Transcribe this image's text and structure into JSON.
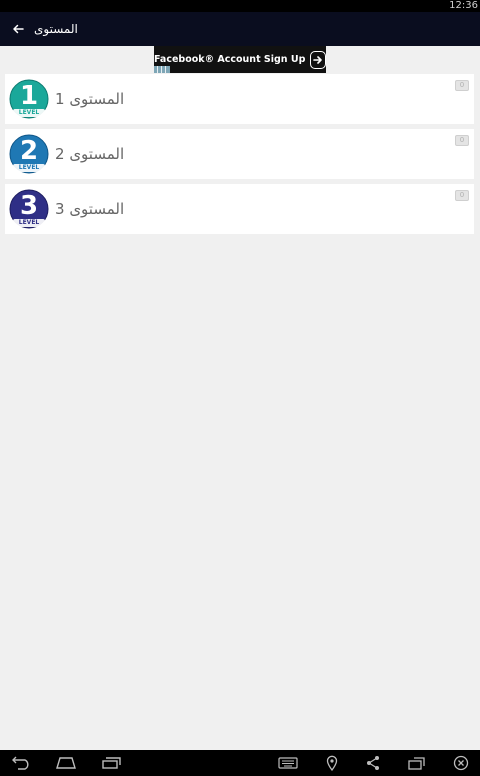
{
  "status_bar": {
    "time": "12:36"
  },
  "action_bar": {
    "title": "المستوى"
  },
  "ad": {
    "text": "Facebook® Account Sign Up"
  },
  "levels": [
    {
      "number": "1",
      "badge_word": "LEVEL",
      "label": "المستوى 1",
      "badge_color": "#1aa89a",
      "corner": "0"
    },
    {
      "number": "2",
      "badge_word": "LEVEL",
      "label": "المستوى 2",
      "badge_color": "#1f78b4",
      "corner": "0"
    },
    {
      "number": "3",
      "badge_word": "LEVEL",
      "label": "المستوى 3",
      "badge_color": "#2f2f86",
      "corner": "0"
    }
  ],
  "colors": {
    "action_bar_bg": "#0a0d1f",
    "page_bg": "#f0f0f0",
    "label_text": "#666666"
  },
  "icons": {
    "back": "arrow-left-icon",
    "nav": [
      "back-icon",
      "home-icon",
      "recent-apps-icon",
      "keyboard-icon",
      "location-icon",
      "share-icon",
      "rotate-icon",
      "close-icon"
    ]
  }
}
